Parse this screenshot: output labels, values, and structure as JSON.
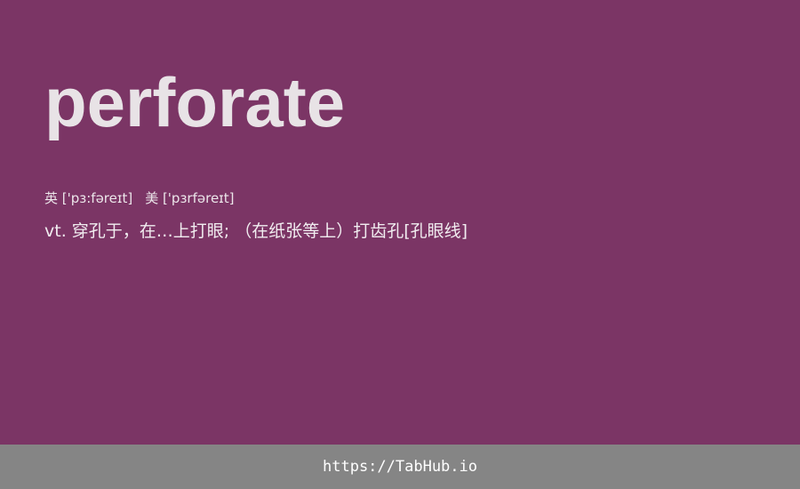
{
  "card": {
    "word": "perforate",
    "phonetics": {
      "uk": "英 ['pɜ:fəreɪt]",
      "us": "美 ['pɜrfəreɪt]"
    },
    "definition": "vt. 穿孔于，在…上打眼; （在纸张等上）打齿孔[孔眼线]"
  },
  "colors": {
    "background": "#7b3565",
    "footer": "#858585",
    "text": "#e8e3e6"
  },
  "footer": {
    "url": "https://TabHub.io"
  }
}
